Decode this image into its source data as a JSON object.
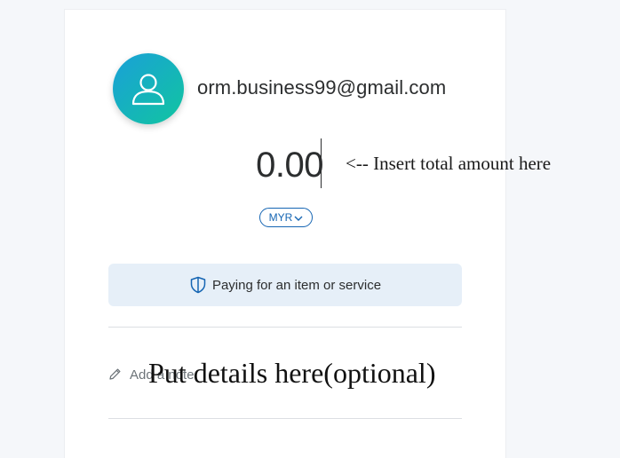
{
  "recipient": {
    "avatar_icon": "user-icon",
    "email": "orm.business99@gmail.com"
  },
  "amount": {
    "value": "0.00",
    "annotation": "<-- Insert total amount here"
  },
  "currency": {
    "selected": "MYR",
    "icon": "chevron-down-icon"
  },
  "payment_type": {
    "icon": "shield-icon",
    "label": "Paying for an item or service"
  },
  "note": {
    "icon": "pencil-icon",
    "placeholder": "Add a note",
    "annotation": "Put details here(optional)"
  },
  "colors": {
    "accent": "#1565b3",
    "avatar_gradient_start": "#1aa0d8",
    "avatar_gradient_end": "#11c5a0",
    "payment_type_bg": "#e6eff8"
  }
}
